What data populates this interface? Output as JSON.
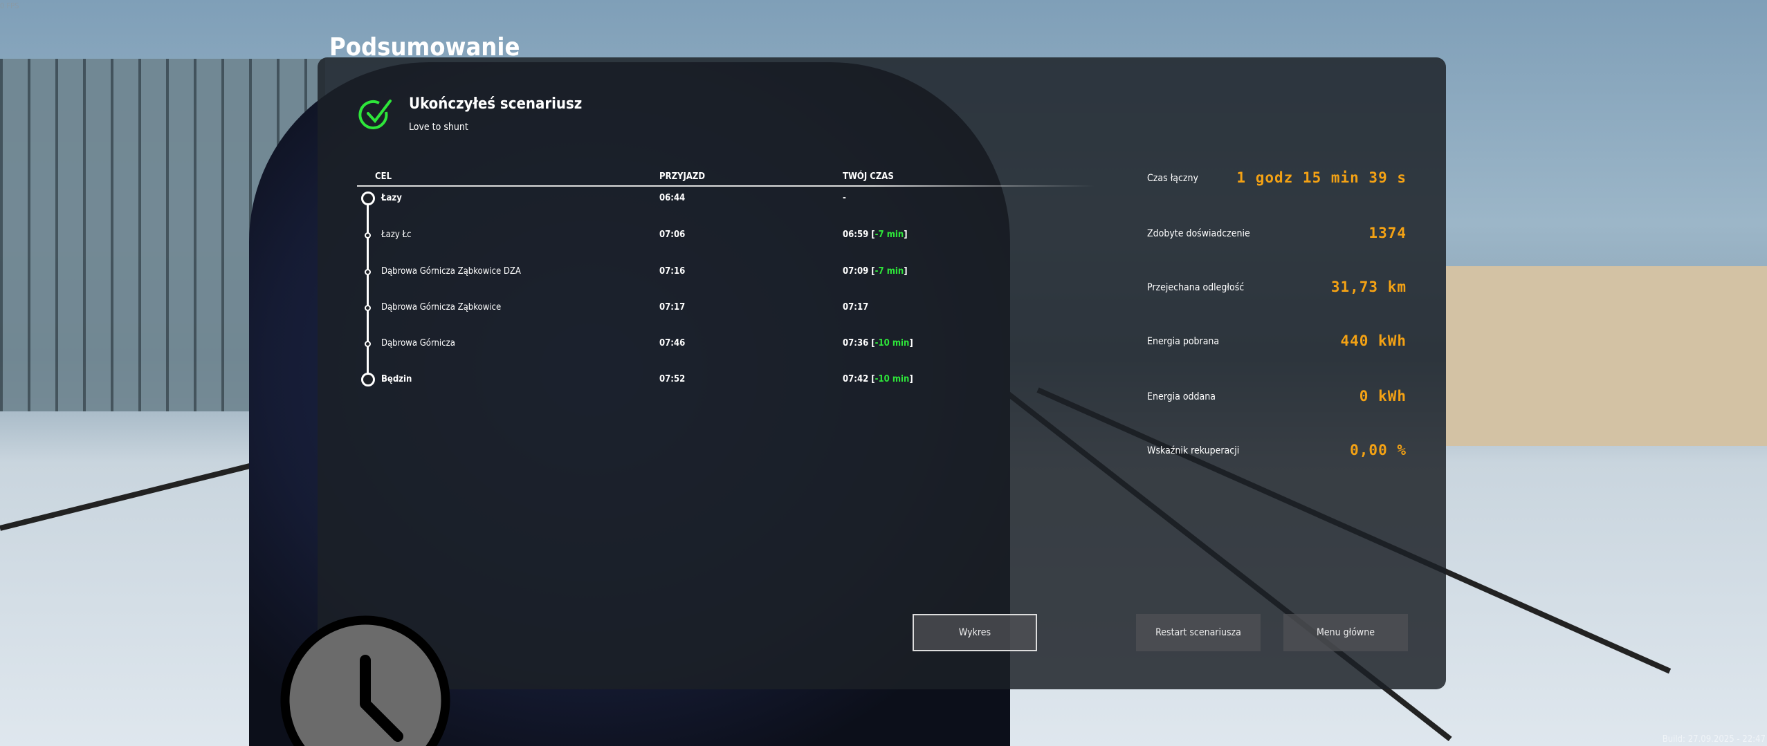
{
  "fps": "0 FPS",
  "title": "Podsumowanie",
  "result": {
    "heading": "Ukończyłeś scenariusz",
    "scenario": "Love to shunt"
  },
  "table": {
    "headers": [
      "CEL",
      "PRZYJAZD",
      "TWÓJ CZAS"
    ],
    "rows": [
      {
        "name": "Łazy",
        "arrival": "06:44",
        "time": "-",
        "diff": "",
        "major": true
      },
      {
        "name": "Łazy Łc",
        "arrival": "07:06",
        "time": "06:59",
        "diff": "-7 min",
        "major": false
      },
      {
        "name": "Dąbrowa Górnicza Ząbkowice DZA",
        "arrival": "07:16",
        "time": "07:09",
        "diff": "-7 min",
        "major": false
      },
      {
        "name": "Dąbrowa Górnicza Ząbkowice",
        "arrival": "07:17",
        "time": "07:17",
        "diff": "",
        "major": false
      },
      {
        "name": "Dąbrowa Górnicza",
        "arrival": "07:46",
        "time": "07:36",
        "diff": "-10 min",
        "major": false
      },
      {
        "name": "Będzin",
        "arrival": "07:52",
        "time": "07:42",
        "diff": "-10 min",
        "major": true
      }
    ]
  },
  "stats": [
    {
      "label": "Czas łączny",
      "value": "1 godz 15 min 39 s"
    },
    {
      "label": "Zdobyte doświadczenie",
      "value": "1374"
    },
    {
      "label": "Przejechana odległość",
      "value": "31,73 km"
    },
    {
      "label": "Energia pobrana",
      "value": "440 kWh"
    },
    {
      "label": "Energia oddana",
      "value": "0 kWh"
    },
    {
      "label": "Wskaźnik rekuperacji",
      "value": "0,00 %"
    }
  ],
  "buttons": {
    "chart": "Wykres",
    "restart": "Restart scenariusza",
    "menu": "Menu główne"
  },
  "build": "Build: 27.09.2025 - 22:47",
  "colors": {
    "accent": "#f4a214",
    "success": "#2ee63a",
    "panel": "#1c2026"
  }
}
